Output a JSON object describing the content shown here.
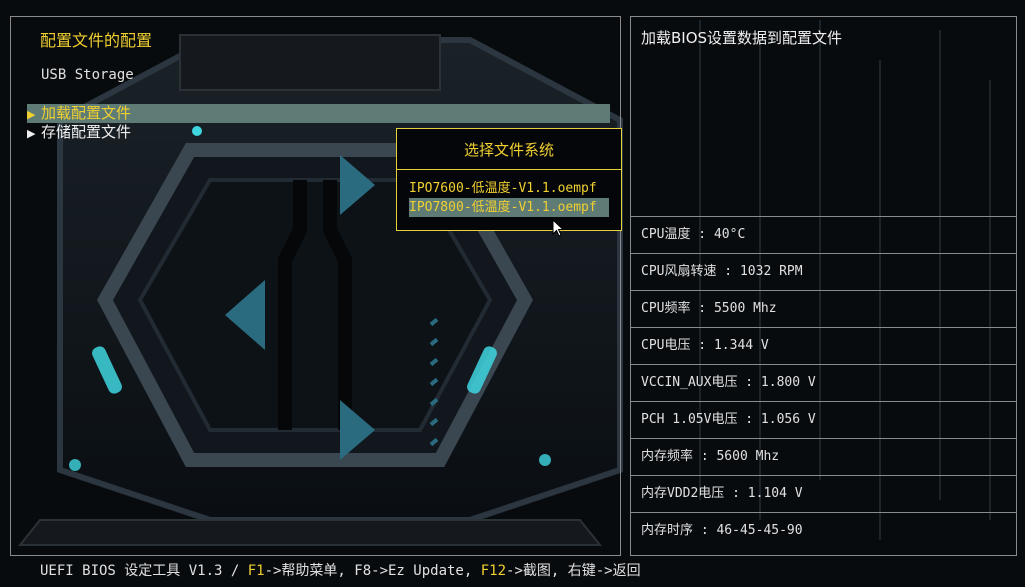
{
  "left": {
    "title": "配置文件的配置",
    "subtitle": "USB Storage",
    "items": [
      {
        "label": "加载配置文件",
        "selected": true
      },
      {
        "label": "存储配置文件",
        "selected": false
      }
    ]
  },
  "right": {
    "description": "加载BIOS设置数据到配置文件",
    "hw": [
      "CPU温度 : 40°C",
      "CPU风扇转速 : 1032 RPM",
      "CPU频率 : 5500 Mhz",
      "CPU电压 : 1.344 V",
      "VCCIN_AUX电压 : 1.800 V",
      "PCH 1.05V电压 : 1.056 V",
      "内存频率 : 5600 Mhz",
      "内存VDD2电压 : 1.104 V",
      "内存时序 : 46-45-45-90"
    ]
  },
  "popup": {
    "title": "选择文件系统",
    "options": [
      {
        "label": "IPO7600-低温度-V1.1.oempf",
        "selected": false
      },
      {
        "label": "IPO7800-低温度-V1.1.oempf",
        "selected": true
      }
    ]
  },
  "status": {
    "prefix": "UEFI BIOS 设定工具 V1.3 / ",
    "f1": "F1",
    "f1_text": "->帮助菜单, F8->Ez Update, ",
    "f12": "F12",
    "f12_text": "->截图, 右键->返回"
  },
  "colors": {
    "accent": "#f0d030",
    "selection": "#5e7b75",
    "border": "#8a8a8a",
    "cyan": "#3fd6e0"
  },
  "icons": [
    "arrow-pointer-icon",
    "menu-arrow-icon"
  ]
}
